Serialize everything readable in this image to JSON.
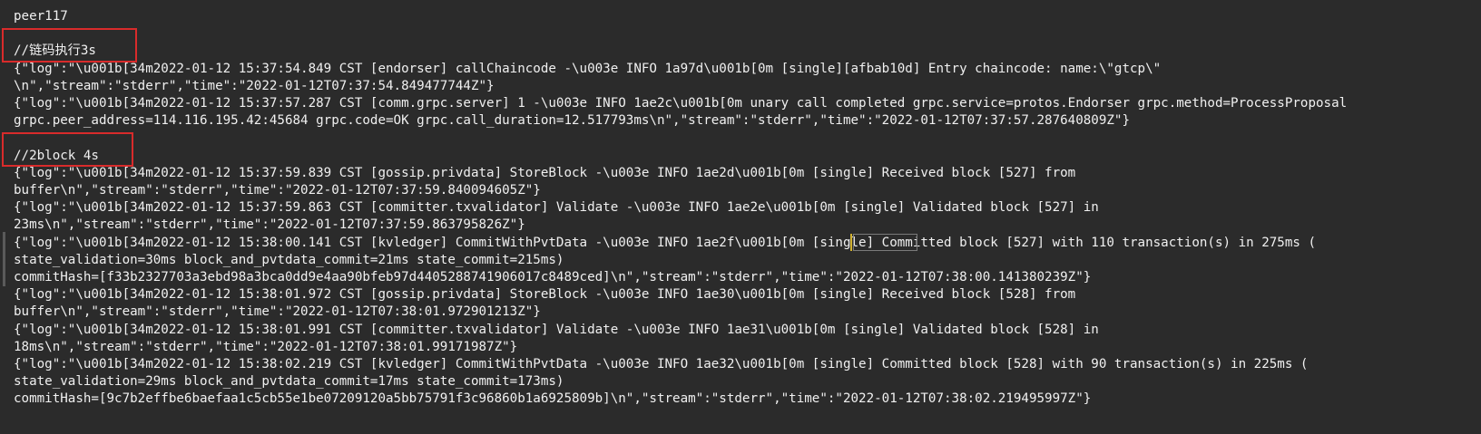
{
  "lines": [
    "peer117",
    "",
    "//链码执行3s",
    "{\"log\":\"\\u001b[34m2022-01-12 15:37:54.849 CST [endorser] callChaincode -\\u003e INFO 1a97d\\u001b[0m [single][afbab10d] Entry chaincode: name:\\\"gtcp\\\"",
    "\\n\",\"stream\":\"stderr\",\"time\":\"2022-01-12T07:37:54.849477744Z\"}",
    "{\"log\":\"\\u001b[34m2022-01-12 15:37:57.287 CST [comm.grpc.server] 1 -\\u003e INFO 1ae2c\\u001b[0m unary call completed grpc.service=protos.Endorser grpc.method=ProcessProposal",
    "grpc.peer_address=114.116.195.42:45684 grpc.code=OK grpc.call_duration=12.517793ms\\n\",\"stream\":\"stderr\",\"time\":\"2022-01-12T07:37:57.287640809Z\"}",
    "",
    "//2block 4s",
    "{\"log\":\"\\u001b[34m2022-01-12 15:37:59.839 CST [gossip.privdata] StoreBlock -\\u003e INFO 1ae2d\\u001b[0m [single] Received block [527] from",
    "buffer\\n\",\"stream\":\"stderr\",\"time\":\"2022-01-12T07:37:59.840094605Z\"}",
    "{\"log\":\"\\u001b[34m2022-01-12 15:37:59.863 CST [committer.txvalidator] Validate -\\u003e INFO 1ae2e\\u001b[0m [single] Validated block [527] in",
    "23ms\\n\",\"stream\":\"stderr\",\"time\":\"2022-01-12T07:37:59.863795826Z\"}",
    "{\"log\":\"\\u001b[34m2022-01-12 15:38:00.141 CST [kvledger] CommitWithPvtData -\\u003e INFO 1ae2f\\u001b[0m [single] Committed block [527] with 110 transaction(s) in 275ms (",
    "state_validation=30ms block_and_pvtdata_commit=21ms state_commit=215ms)",
    "commitHash=[f33b2327703a3ebd98a3bca0dd9e4aa90bfeb97d4405288741906017c8489ced]\\n\",\"stream\":\"stderr\",\"time\":\"2022-01-12T07:38:00.141380239Z\"}",
    "{\"log\":\"\\u001b[34m2022-01-12 15:38:01.972 CST [gossip.privdata] StoreBlock -\\u003e INFO 1ae30\\u001b[0m [single] Received block [528] from",
    "buffer\\n\",\"stream\":\"stderr\",\"time\":\"2022-01-12T07:38:01.972901213Z\"}",
    "{\"log\":\"\\u001b[34m2022-01-12 15:38:01.991 CST [committer.txvalidator] Validate -\\u003e INFO 1ae31\\u001b[0m [single] Validated block [528] in",
    "18ms\\n\",\"stream\":\"stderr\",\"time\":\"2022-01-12T07:38:01.99171987Z\"}",
    "{\"log\":\"\\u001b[34m2022-01-12 15:38:02.219 CST [kvledger] CommitWithPvtData -\\u003e INFO 1ae32\\u001b[0m [single] Committed block [528] with 90 transaction(s) in 225ms (",
    "state_validation=29ms block_and_pvtdata_commit=17ms state_commit=173ms)",
    "commitHash=[9c7b2effbe6baefaa1c5cb55e1be07209120a5bb75791f3c96860b1a6925809b]\\n\",\"stream\":\"stderr\",\"time\":\"2022-01-12T07:38:02.219495997Z\"}"
  ],
  "colors": {
    "background": "#2b2b2b",
    "text": "#f0f0f0",
    "annotation_border": "#d92b2b",
    "cursor": "#d0b030"
  }
}
